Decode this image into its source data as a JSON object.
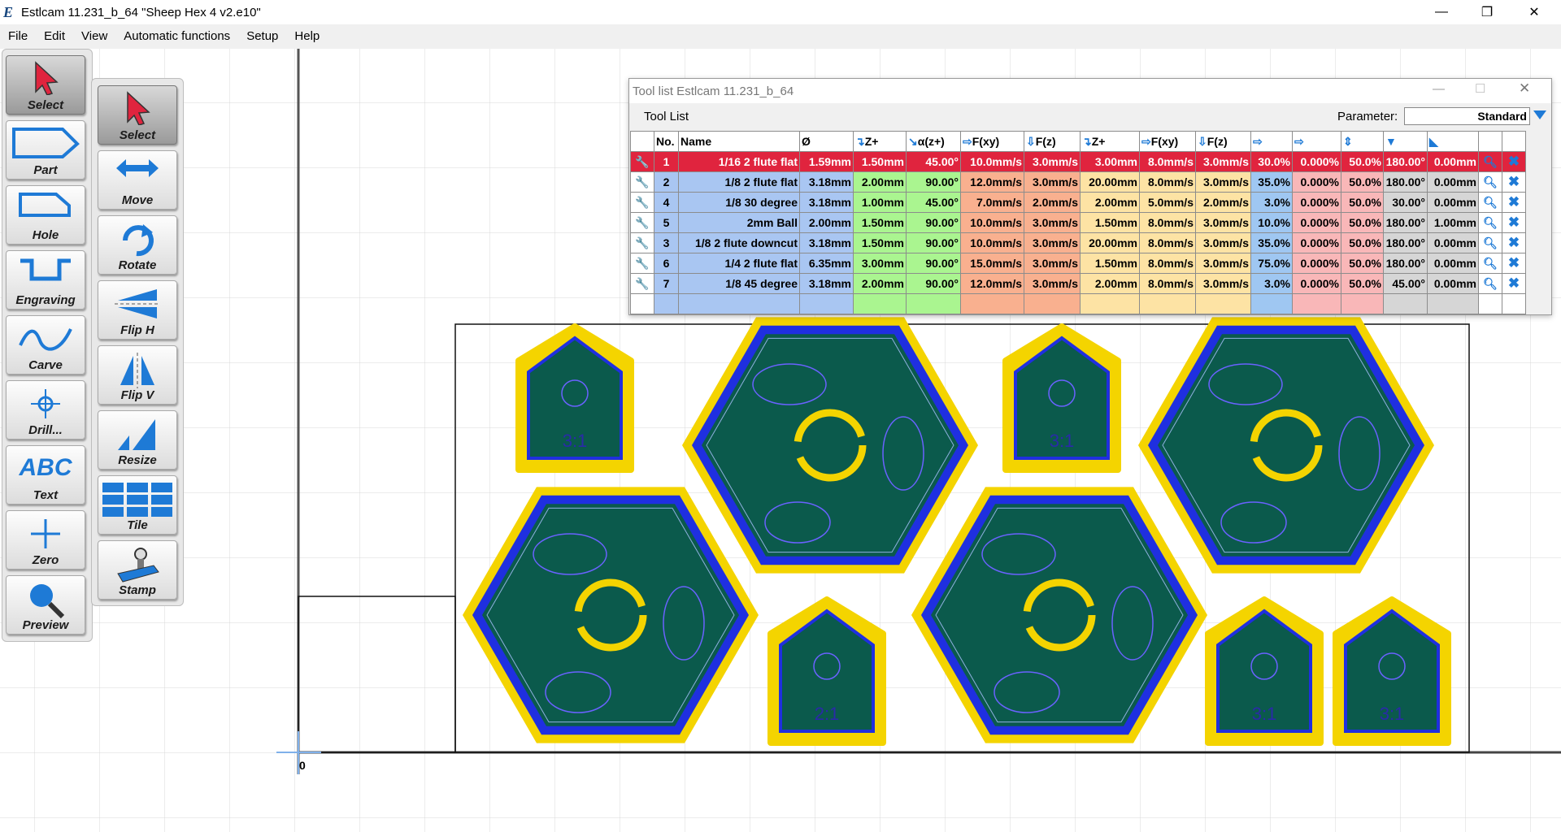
{
  "window": {
    "title": "Estlcam 11.231_b_64 \"Sheep Hex 4 v2.e10\"",
    "minimize": "—",
    "restore": "❐",
    "close": "✕"
  },
  "menu": [
    "File",
    "Edit",
    "View",
    "Automatic functions",
    "Setup",
    "Help"
  ],
  "tools_left": [
    {
      "label": "Select",
      "icon": "select-arrow-icon"
    },
    {
      "label": "Part",
      "icon": "part-outline-icon"
    },
    {
      "label": "Hole",
      "icon": "hole-outline-icon"
    },
    {
      "label": "Engraving",
      "icon": "engraving-groove-icon"
    },
    {
      "label": "Carve",
      "icon": "carve-wave-icon"
    },
    {
      "label": "Drill...",
      "icon": "drill-crosshair-icon"
    },
    {
      "label": "Text",
      "icon": "text-abc-icon"
    },
    {
      "label": "Zero",
      "icon": "zero-cross-icon"
    },
    {
      "label": "Preview",
      "icon": "magnifier-icon"
    }
  ],
  "tools_right": [
    {
      "label": "Select",
      "icon": "select-arrow-icon"
    },
    {
      "label": "Move",
      "icon": "move-arrows-icon"
    },
    {
      "label": "Rotate",
      "icon": "rotate-icon"
    },
    {
      "label": "Flip H",
      "icon": "flip-h-icon"
    },
    {
      "label": "Flip V",
      "icon": "flip-v-icon"
    },
    {
      "label": "Resize",
      "icon": "resize-icon"
    },
    {
      "label": "Tile",
      "icon": "tile-grid-icon"
    },
    {
      "label": "Stamp",
      "icon": "stamp-icon"
    }
  ],
  "toollist": {
    "title": "Tool list Estlcam 11.231_b_64",
    "tab": "Tool List",
    "parameter_label": "Parameter:",
    "parameter_value": "Standard",
    "headers": [
      "",
      "No.",
      "Name",
      "Ø",
      "Z+",
      "α(z+)",
      "F(xy)",
      "F(z)",
      "Z+",
      "F(xy)",
      "F(z)",
      "",
      "",
      "",
      "",
      "",
      "",
      ""
    ],
    "rows": [
      {
        "no": "1",
        "name": "1/16 2 flute flat",
        "d": "1.59mm",
        "z": "1.50mm",
        "a": "45.00°",
        "fxy": "10.0mm/s",
        "fz": "3.0mm/s",
        "z2": "3.00mm",
        "fxy2": "8.0mm/s",
        "fz2": "3.0mm/s",
        "p1": "30.0%",
        "p2": "0.000%",
        "p3": "50.0%",
        "ang": "180.00°",
        "off": "0.00mm",
        "selected": true
      },
      {
        "no": "2",
        "name": "1/8 2 flute flat",
        "d": "3.18mm",
        "z": "2.00mm",
        "a": "90.00°",
        "fxy": "12.0mm/s",
        "fz": "3.0mm/s",
        "z2": "20.00mm",
        "fxy2": "8.0mm/s",
        "fz2": "3.0mm/s",
        "p1": "35.0%",
        "p2": "0.000%",
        "p3": "50.0%",
        "ang": "180.00°",
        "off": "0.00mm"
      },
      {
        "no": "4",
        "name": "1/8 30 degree",
        "d": "3.18mm",
        "z": "1.00mm",
        "a": "45.00°",
        "fxy": "7.0mm/s",
        "fz": "2.0mm/s",
        "z2": "2.00mm",
        "fxy2": "5.0mm/s",
        "fz2": "2.0mm/s",
        "p1": "3.0%",
        "p2": "0.000%",
        "p3": "50.0%",
        "ang": "30.00°",
        "off": "0.00mm"
      },
      {
        "no": "5",
        "name": "2mm Ball",
        "d": "2.00mm",
        "z": "1.50mm",
        "a": "90.00°",
        "fxy": "10.0mm/s",
        "fz": "3.0mm/s",
        "z2": "1.50mm",
        "fxy2": "8.0mm/s",
        "fz2": "3.0mm/s",
        "p1": "10.0%",
        "p2": "0.000%",
        "p3": "50.0%",
        "ang": "180.00°",
        "off": "1.00mm"
      },
      {
        "no": "3",
        "name": "1/8 2 flute downcut",
        "d": "3.18mm",
        "z": "1.50mm",
        "a": "90.00°",
        "fxy": "10.0mm/s",
        "fz": "3.0mm/s",
        "z2": "20.00mm",
        "fxy2": "8.0mm/s",
        "fz2": "3.0mm/s",
        "p1": "35.0%",
        "p2": "0.000%",
        "p3": "50.0%",
        "ang": "180.00°",
        "off": "0.00mm"
      },
      {
        "no": "6",
        "name": "1/4 2 flute flat",
        "d": "6.35mm",
        "z": "3.00mm",
        "a": "90.00°",
        "fxy": "15.0mm/s",
        "fz": "3.0mm/s",
        "z2": "1.50mm",
        "fxy2": "8.0mm/s",
        "fz2": "3.0mm/s",
        "p1": "75.0%",
        "p2": "0.000%",
        "p3": "50.0%",
        "ang": "180.00°",
        "off": "0.00mm"
      },
      {
        "no": "7",
        "name": "1/8 45 degree",
        "d": "3.18mm",
        "z": "2.00mm",
        "a": "90.00°",
        "fxy": "12.0mm/s",
        "fz": "3.0mm/s",
        "z2": "2.00mm",
        "fxy2": "8.0mm/s",
        "fz2": "3.0mm/s",
        "p1": "3.0%",
        "p2": "0.000%",
        "p3": "50.0%",
        "ang": "45.00°",
        "off": "0.00mm"
      }
    ]
  },
  "canvas": {
    "origin_label": "0",
    "token_labels": [
      "3:1",
      "3:1",
      "2:1",
      "3:1",
      "3:1"
    ]
  },
  "colors": {
    "part_fill": "#0b5a4c",
    "yellow": "#f4d400",
    "blue": "#1f2fe0",
    "line": "#6a62ff",
    "accent": "#1e7ad6",
    "selected_row": "#e0243e"
  }
}
